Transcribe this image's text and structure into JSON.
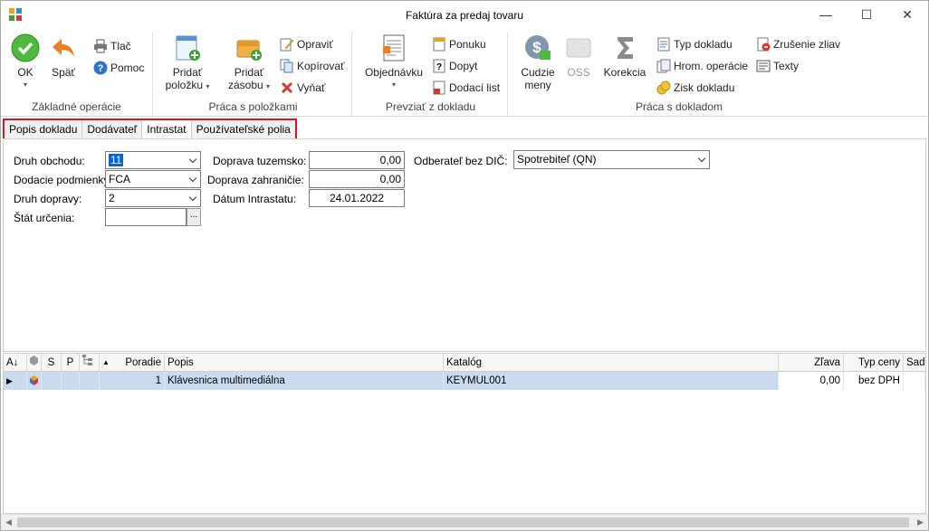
{
  "window": {
    "title": "Faktúra za predaj tovaru",
    "minimize": "—",
    "maximize": "☐",
    "close": "✕"
  },
  "ribbon": {
    "zakladne": {
      "label": "Základné operácie",
      "ok": "OK",
      "spat": "Späť",
      "tlac": "Tlač",
      "pomoc": "Pomoc"
    },
    "polozky": {
      "label": "Práca s položkami",
      "pridat_polozku_1": "Pridať",
      "pridat_polozku_2": "položku",
      "pridat_zasobu_1": "Pridať",
      "pridat_zasobu_2": "zásobu",
      "opravit": "Opraviť",
      "kopirovat": "Kopírovať",
      "vyniat": "Vyňať"
    },
    "prevziat": {
      "label": "Prevziať z dokladu",
      "objednavku": "Objednávku",
      "ponuku": "Ponuku",
      "dopyt": "Dopyt",
      "dodaci_list": "Dodací list"
    },
    "doklad": {
      "label": "Práca s dokladom",
      "cudzie_meny_1": "Cudzie",
      "cudzie_meny_2": "meny",
      "oss": "OSS",
      "korekcia": "Korekcia",
      "typ_dokladu": "Typ dokladu",
      "hrom_operacie": "Hrom. operácie",
      "zisk_dokladu": "Zisk dokladu",
      "zrusenie_zliav": "Zrušenie zliav",
      "texty": "Texty"
    },
    "ok_color": "#3aa132"
  },
  "tabs": [
    "Popis dokladu",
    "Dodávateľ",
    "Intrastat",
    "Používateľské polia"
  ],
  "active_tab": "Intrastat",
  "form": {
    "druh_obchodu": {
      "label": "Druh obchodu:",
      "value": "11"
    },
    "dodacie_podmienky": {
      "label": "Dodacie podmienky:",
      "value": "FCA"
    },
    "druh_dopravy": {
      "label": "Druh dopravy:",
      "value": "2"
    },
    "stat_urcenia": {
      "label": "Štát určenia:",
      "value": "",
      "button": "..."
    },
    "doprava_tuzemsko": {
      "label": "Doprava tuzemsko:",
      "value": "0,00"
    },
    "doprava_zahranicie": {
      "label": "Doprava zahraničie:",
      "value": "0,00"
    },
    "datum_intrastatu": {
      "label": "Dátum Intrastatu:",
      "value": "24.01.2022"
    },
    "odberatel_bez_dic": {
      "label": "Odberateľ bez DIČ:",
      "value": "Spotrebiteľ (QN)"
    }
  },
  "grid": {
    "columns": {
      "s": "S",
      "p": "P",
      "poradie": "Poradie",
      "popis": "Popis",
      "katalog": "Katalóg",
      "zlava": "Zľava",
      "typ_ceny": "Typ ceny",
      "sadzba": "Sadz"
    },
    "rows": [
      {
        "poradie": "1",
        "popis": "Klávesnica multimediálna",
        "katalog": "KEYMUL001",
        "zlava": "0,00",
        "typ_ceny": "bez DPH"
      }
    ]
  }
}
